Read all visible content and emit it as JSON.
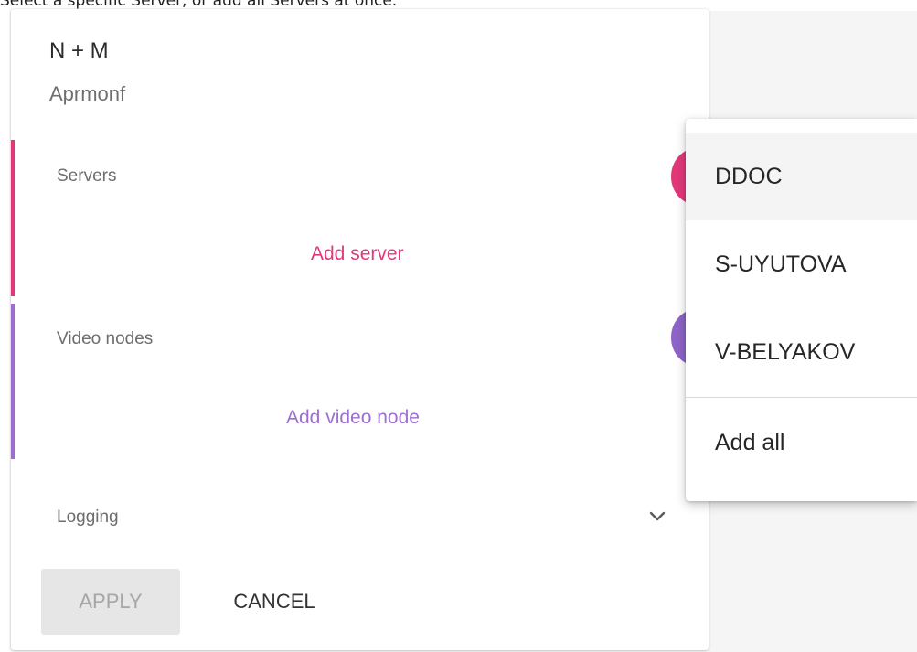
{
  "instruction": "Select a specific Server, or add all Servers at once.",
  "panel": {
    "title": "N + M",
    "subtitle": "Aprmonf"
  },
  "sections": {
    "servers": {
      "label": "Servers",
      "add_label": "Add server",
      "accent": "#e2387a"
    },
    "video_nodes": {
      "label": "Video nodes",
      "add_label": "Add video node",
      "accent": "#9b6fd0"
    },
    "logging": {
      "label": "Logging",
      "icon": "chevron-down-icon"
    }
  },
  "actions": {
    "apply_label": "APPLY",
    "cancel_label": "CANCEL"
  },
  "menu": {
    "items": [
      {
        "label": "DDOC",
        "highlighted": true
      },
      {
        "label": "S-UYUTOVA",
        "highlighted": false
      },
      {
        "label": "V-BELYAKOV",
        "highlighted": false
      }
    ],
    "add_all_label": "Add all"
  }
}
